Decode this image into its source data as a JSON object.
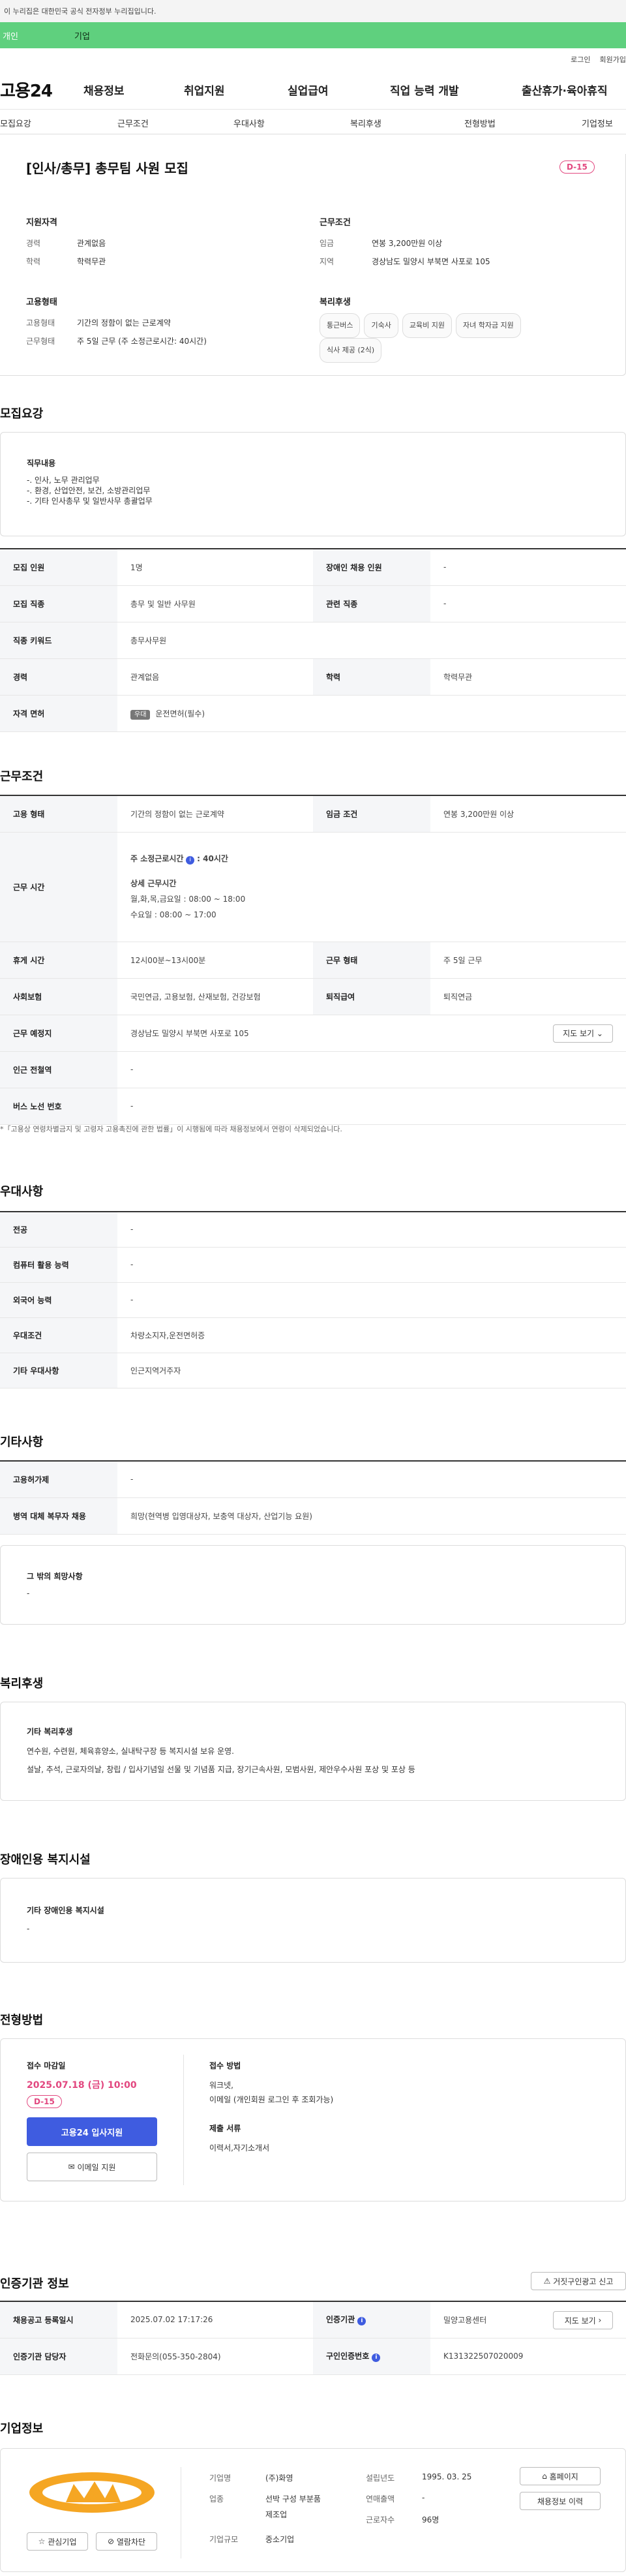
{
  "gov_banner": "이 누리집은 대한민국 공식 전자정부 누리집입니다.",
  "top_tabs": [
    "개인",
    "기업"
  ],
  "util_links": [
    "로그인",
    "회원가입"
  ],
  "logo": "고용24",
  "gnb": [
    "채용정보",
    "취업지원",
    "실업급여",
    "직업 능력 개발",
    "출산휴가·육아휴직"
  ],
  "subnav": [
    "모집요강",
    "근무조건",
    "우대사항",
    "복리후생",
    "전형방법",
    "기업정보"
  ],
  "job": {
    "title": "[인사/총무] 총무팀 사원 모집",
    "dday": "D-15",
    "qual_title": "지원자격",
    "career_lbl": "경력",
    "career_val": "관계없음",
    "edu_lbl": "학력",
    "edu_val": "학력무관",
    "work_title": "근무조건",
    "wage_lbl": "임금",
    "wage_val": "연봉 3,200만원 이상",
    "region_lbl": "지역",
    "region_val": "경상남도 밀양시 부북면 사포로 105",
    "emp_title": "고용형태",
    "emptype_lbl": "고용형태",
    "emptype_val": "기간의 정함이 없는 근로계약",
    "worktype_lbl": "근무형태",
    "worktype_val": "주 5일 근무 (주 소정근로시간: 40시간)",
    "welfare_title": "복리후생",
    "welfare_chips": [
      "통근버스",
      "기숙사",
      "교육비 지원",
      "자녀 학자금 지원",
      "식사 제공 (2식)"
    ]
  },
  "recruit": {
    "title": "모집요강",
    "duty_title": "직무내용",
    "duty_lines": [
      "-. 인사, 노무 관리업무",
      "-. 환경, 산업안전, 보건, 소방관리업무",
      "-. 기타 인사총무 및 일반사무 총괄업무"
    ],
    "rows": [
      [
        "모집 인원",
        "1명",
        "장애인 채용 인원",
        "-"
      ],
      [
        "모집 직종",
        "총무 및 일반 사무원",
        "관련 직종",
        "-"
      ],
      [
        "직종 키워드",
        "총무사무원",
        "",
        ""
      ],
      [
        "경력",
        "관계없음",
        "학력",
        "학력무관"
      ]
    ],
    "license_lbl": "자격 면허",
    "license_tag": "우대",
    "license_val": "운전면허(필수)"
  },
  "conditions": {
    "title": "근무조건",
    "emptype_lbl": "고용 형태",
    "emptype_val": "기간의 정함이 없는 근로계약",
    "wagecond_lbl": "임금 조건",
    "wagecond_val": "연봉 3,200만원 이상",
    "hours_lbl": "근무 시간",
    "hours_main": "주 소정근로시간",
    "hours_main_val": ": 40시간",
    "hours_detail_title": "상세 근무시간",
    "hours_line1": "월,화,목,금요일 : 08:00 ~ 18:00",
    "hours_line2": "수요일 : 08:00 ~ 17:00",
    "break_lbl": "휴게 시간",
    "break_val": "12시00분~13시00분",
    "shift_lbl": "근무 형태",
    "shift_val": "주 5일 근무",
    "ins_lbl": "사회보험",
    "ins_val": "국민연금, 고용보험, 산재보험, 건강보험",
    "retire_lbl": "퇴직급여",
    "retire_val": "퇴직연금",
    "place_lbl": "근무 예정지",
    "place_val": "경상남도 밀양시 부북면 사포로 105",
    "map_btn": "지도 보기",
    "subway_lbl": "인근 전철역",
    "subway_val": "-",
    "bus_lbl": "버스 노선 번호",
    "bus_val": "-",
    "note": "*「고용상 연령차별금지 및 고령자 고용촉진에 관한 법률」이 시행됨에 따라 채용정보에서 연령이 삭제되었습니다."
  },
  "prefer": {
    "title": "우대사항",
    "rows": [
      [
        "전공",
        "-"
      ],
      [
        "컴퓨터 활용 능력",
        "-"
      ],
      [
        "외국어 능력",
        "-"
      ],
      [
        "우대조건",
        "차량소지자,운전면허증"
      ],
      [
        "기타 우대사항",
        "인근지역거주자"
      ]
    ]
  },
  "etc": {
    "title": "기타사항",
    "rows": [
      [
        "고용허가제",
        "-"
      ],
      [
        "병역 대체 복무자 채용",
        "희망(현역병 입영대상자, 보충역 대상자, 산업기능 요원)"
      ]
    ],
    "wish_title": "그 밖의 희망사항",
    "wish_val": "-"
  },
  "benefit": {
    "title": "복리후생",
    "box_title": "기타 복리후생",
    "line1": "연수원, 수련원, 체육휴양소, 실내탁구장 등 복지시설 보유 운영.",
    "line2": "설날, 추석, 근로자의날, 창립 / 입사기념일 선물 및 기념품 지급, 장기근속사원, 모범사원, 제안우수사원 포상 및 포상 등"
  },
  "disabled": {
    "title": "장애인용 복지시설",
    "box_title": "기타 장애인용 복지시설",
    "val": "-"
  },
  "process": {
    "title": "전형방법",
    "deadline_lbl": "접수 마감일",
    "deadline_val": "2025.07.18 (금) 10:00",
    "dday": "D-15",
    "apply_btn": "고용24 입사지원",
    "email_btn": "이메일 지원",
    "method_lbl": "접수 방법",
    "method_line1": "워크넷,",
    "method_line2": "이메일 (개인회원 로그인 후 조회가능)",
    "docs_lbl": "제출 서류",
    "docs_val": "이력서,자기소개서"
  },
  "agency": {
    "title": "인증기관 정보",
    "report_btn": "거짓구인광고 신고",
    "reg_lbl": "채용공고 등록일시",
    "reg_val": "2025.07.02 17:17:26",
    "org_lbl": "인증기관",
    "org_val": "밀양고용센터",
    "map_btn": "지도 보기",
    "staff_lbl": "인증기관 담당자",
    "staff_val": "전화문의(055-350-2804)",
    "num_lbl": "구인인증번호",
    "num_val": "K131322507020009"
  },
  "company": {
    "title": "기업정보",
    "name_lbl": "기업명",
    "name_val": "(주)화영",
    "ind_lbl": "업종",
    "ind_val1": "선박 구성 부분품",
    "ind_val2": "제조업",
    "size_lbl": "기업규모",
    "size_val": "중소기업",
    "est_lbl": "설립년도",
    "est_val": "1995. 03. 25",
    "sales_lbl": "연매출액",
    "sales_val": "-",
    "emp_lbl": "근로자수",
    "emp_val": "96명",
    "fav_btn": "관심기업",
    "view_btn": "열람차단",
    "home_btn": "홈페이지",
    "history_btn": "채용정보 이력"
  },
  "colors": {
    "brand": "#5fd07e",
    "primary_btn": "#3f5ce0",
    "dday": "#e2477f",
    "deadline": "#e2477f"
  }
}
